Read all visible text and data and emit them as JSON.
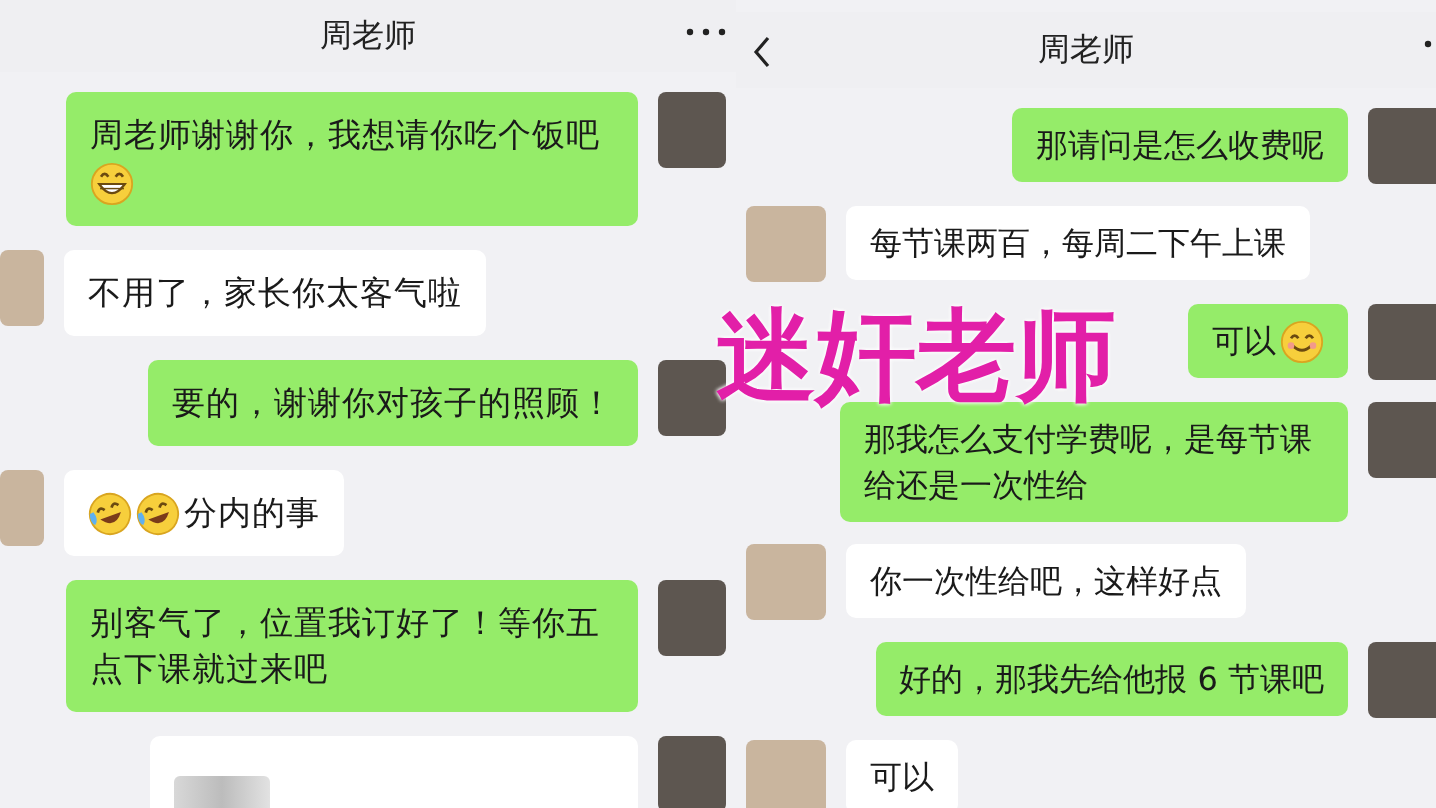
{
  "panels": [
    {
      "header": {
        "title": "周老师",
        "has_back": false
      },
      "messages": [
        {
          "outgoing": true,
          "segments": [
            {
              "kind": "text",
              "text": "周老师谢谢你，我想请你吃个饭吧"
            },
            {
              "kind": "emoji_grin"
            }
          ]
        },
        {
          "outgoing": false,
          "segments": [
            {
              "kind": "text",
              "text": "不用了，家长你太客气啦"
            }
          ]
        },
        {
          "outgoing": true,
          "segments": [
            {
              "kind": "text",
              "text": "要的，谢谢你对孩子的照顾！"
            }
          ]
        },
        {
          "outgoing": false,
          "segments": [
            {
              "kind": "emoji_laugh"
            },
            {
              "kind": "emoji_laugh"
            },
            {
              "kind": "text",
              "text": "分内的事"
            }
          ]
        },
        {
          "outgoing": true,
          "segments": [
            {
              "kind": "text",
              "text": "别客气了，位置我订好了！等你五点下课就过来吧"
            }
          ]
        },
        {
          "outgoing": true,
          "segments": [
            {
              "kind": "image"
            }
          ]
        }
      ]
    },
    {
      "header": {
        "title": "周老师",
        "has_back": true
      },
      "messages": [
        {
          "outgoing": true,
          "segments": [
            {
              "kind": "text",
              "text": "那请问是怎么收费呢"
            }
          ]
        },
        {
          "outgoing": false,
          "segments": [
            {
              "kind": "text",
              "text": "每节课两百，每周二下午上课"
            }
          ]
        },
        {
          "outgoing": true,
          "segments": [
            {
              "kind": "text",
              "text": "可以"
            },
            {
              "kind": "emoji_smile"
            }
          ]
        },
        {
          "outgoing": true,
          "segments": [
            {
              "kind": "text",
              "text": "那我怎么支付学费呢，是每节课给还是一次性给"
            }
          ]
        },
        {
          "outgoing": false,
          "segments": [
            {
              "kind": "text",
              "text": "你一次性给吧，这样好点"
            }
          ]
        },
        {
          "outgoing": true,
          "segments": [
            {
              "kind": "text",
              "text": "好的，那我先给他报 6 节课吧"
            }
          ]
        },
        {
          "outgoing": false,
          "segments": [
            {
              "kind": "text",
              "text": "可以"
            }
          ]
        }
      ]
    }
  ],
  "caption": "迷奸老师"
}
